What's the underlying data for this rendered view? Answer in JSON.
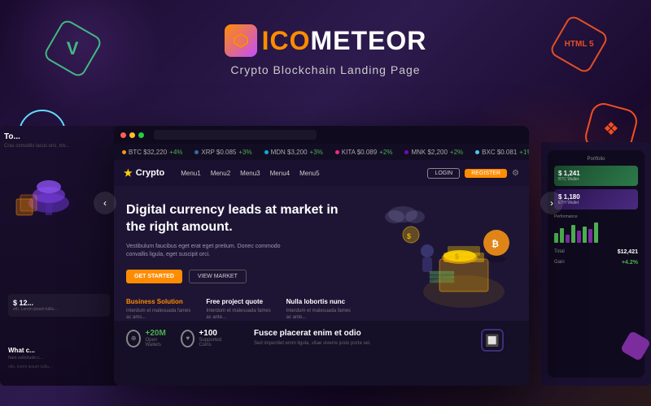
{
  "app": {
    "title": "ICOMeteor",
    "logo_ico": "ICO",
    "logo_meteor": "METEOR",
    "subtitle": "Crypto Blockchain Landing Page"
  },
  "badges": {
    "vue": {
      "label": "V",
      "color": "#42b883"
    },
    "react": {
      "label": "⚛",
      "color": "#61dafb"
    },
    "html5": {
      "label": "HTML\n5",
      "color": "#e34f26"
    },
    "figma": {
      "label": "❖",
      "color": "#f24e1e"
    }
  },
  "browser": {
    "ticker": [
      {
        "symbol": "BTC",
        "price": "$32,220",
        "change": "+4%",
        "up": true
      },
      {
        "symbol": "XRP",
        "price": "$0.085",
        "change": "+3%",
        "up": true
      },
      {
        "symbol": "MDN",
        "price": "$3,200",
        "change": "+3%",
        "up": true
      },
      {
        "symbol": "KITA",
        "price": "$0.089",
        "change": "+2%",
        "up": true
      },
      {
        "symbol": "MNK",
        "price": "$2,200",
        "change": "+2%",
        "up": true
      },
      {
        "symbol": "BXC",
        "price": "$0.081",
        "change": "+1%",
        "up": true
      }
    ],
    "nav": {
      "logo_star": "★",
      "logo_text": "Crypto",
      "menu": [
        "Menu1",
        "Menu2",
        "Menu3",
        "Menu4",
        "Menu5"
      ],
      "login": "LOGIN",
      "register": "REGISTER",
      "gear": "⚙"
    },
    "hero": {
      "title": "Digital currency leads at market\nin the right amount.",
      "description": "Vestibulum faucibus eget erat eget pretium. Donec commodo convallis ligula, eget suscipit orci.",
      "btn_started": "GET STARTED",
      "btn_market": "VIEW MARKET"
    },
    "features": [
      {
        "title": "Business Solution",
        "description": "Interdum et malesuada fames ac ams..."
      },
      {
        "title": "Free project quote",
        "description": "Interdum et malesuada fames ac ante..."
      },
      {
        "title": "Nulla lobortis nunc",
        "description": "Interdum et malesuada fames ac ante..."
      }
    ],
    "bottom": {
      "title": "Fusce placerat enim et odio",
      "description": "Sed imperdiet enim ligula, vitae viverre justo porta vel.",
      "stat1_number": "+20M",
      "stat1_label": "Open Wallets",
      "stat2_number": "+100",
      "stat2_label": "Supported Coins"
    }
  },
  "left_panel": {
    "title": "To...",
    "text": "Cras convallis lacus orci, tris...",
    "card1_price": "$ 12...",
    "card1_label": "eth. Lorem ipsum tulliu...",
    "sub_title": "What c...",
    "sub_text": "Nam sollicitudin c..."
  },
  "right_panel": {
    "cards": [
      {
        "value": "$ 1,241",
        "label": "BTC Wallet",
        "color": "green"
      },
      {
        "value": "$ 1,180",
        "label": "ETH Wallet",
        "color": "purple"
      }
    ],
    "chart_bars": [
      12,
      18,
      10,
      22,
      15,
      20,
      17,
      25
    ]
  },
  "navigation": {
    "left_arrow": "‹",
    "right_arrow": "›"
  }
}
